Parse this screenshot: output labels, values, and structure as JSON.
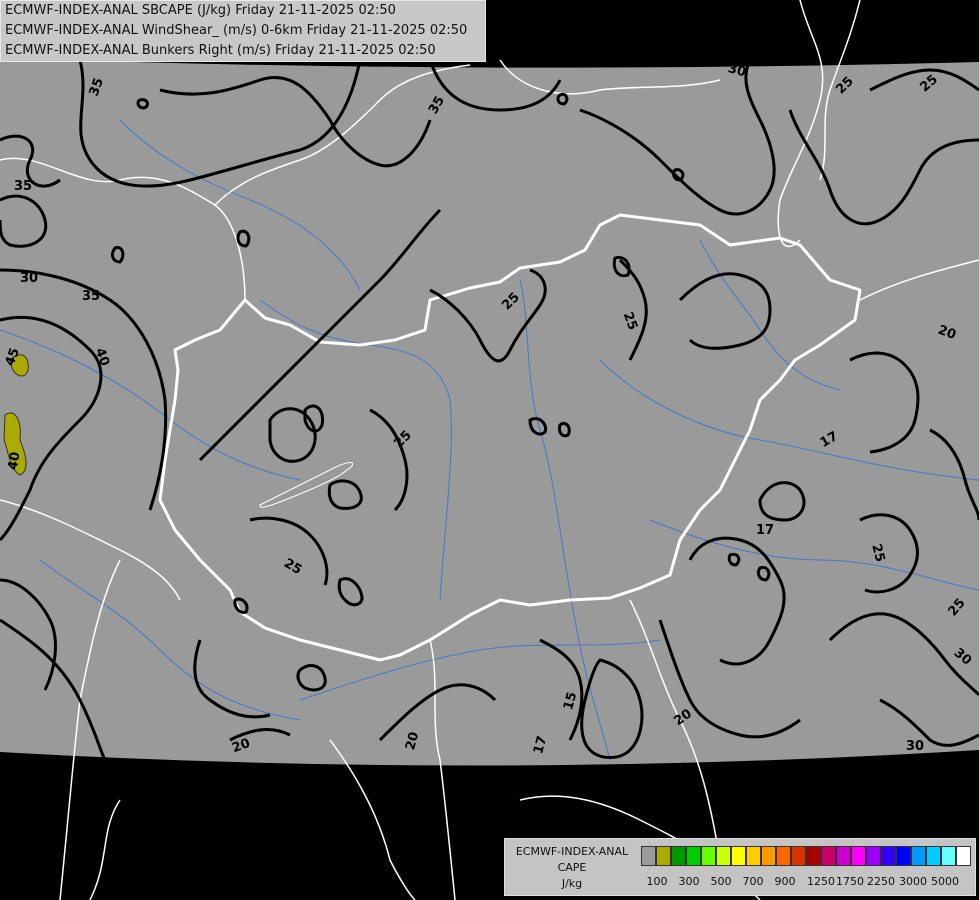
{
  "header": {
    "line1": "ECMWF-INDEX-ANAL SBCAPE (J/kg) Friday 21-11-2025 02:50",
    "line2": "ECMWF-INDEX-ANAL WindShear_ (m/s) 0-6km Friday 21-11-2025 02:50",
    "line3": "ECMWF-INDEX-ANAL Bunkers Right (m/s) Friday 21-11-2025 02:50"
  },
  "legend": {
    "title1": "ECMWF-INDEX-ANAL",
    "title2": "CAPE",
    "unit": "J/kg",
    "colors": [
      "#9a9a9a",
      "#aaaa00",
      "#009900",
      "#00cc00",
      "#66ff00",
      "#ccff00",
      "#ffff00",
      "#ffcc00",
      "#ff9900",
      "#ff6600",
      "#dd3300",
      "#aa0000",
      "#cc0066",
      "#cc00cc",
      "#ff00ff",
      "#9900ff",
      "#3300ff",
      "#0000ff",
      "#0099ff",
      "#00ccff",
      "#66ffff",
      "#ffffff"
    ],
    "ticks": [
      "100",
      "300",
      "500",
      "700",
      "900",
      "1250",
      "1750",
      "2250",
      "3000",
      "5000"
    ]
  },
  "contour_labels": [
    {
      "text": "35"
    },
    {
      "text": "35"
    },
    {
      "text": "35"
    },
    {
      "text": "35"
    },
    {
      "text": "30"
    },
    {
      "text": "30"
    },
    {
      "text": "25"
    },
    {
      "text": "25"
    },
    {
      "text": "25"
    },
    {
      "text": "25"
    },
    {
      "text": "25"
    },
    {
      "text": "25"
    },
    {
      "text": "25"
    },
    {
      "text": "25"
    },
    {
      "text": "20"
    },
    {
      "text": "20"
    },
    {
      "text": "20"
    },
    {
      "text": "20"
    },
    {
      "text": "17"
    },
    {
      "text": "17"
    },
    {
      "text": "17"
    },
    {
      "text": "15"
    },
    {
      "text": "30"
    },
    {
      "text": "30"
    },
    {
      "text": "40"
    },
    {
      "text": "45"
    },
    {
      "text": "40"
    }
  ]
}
